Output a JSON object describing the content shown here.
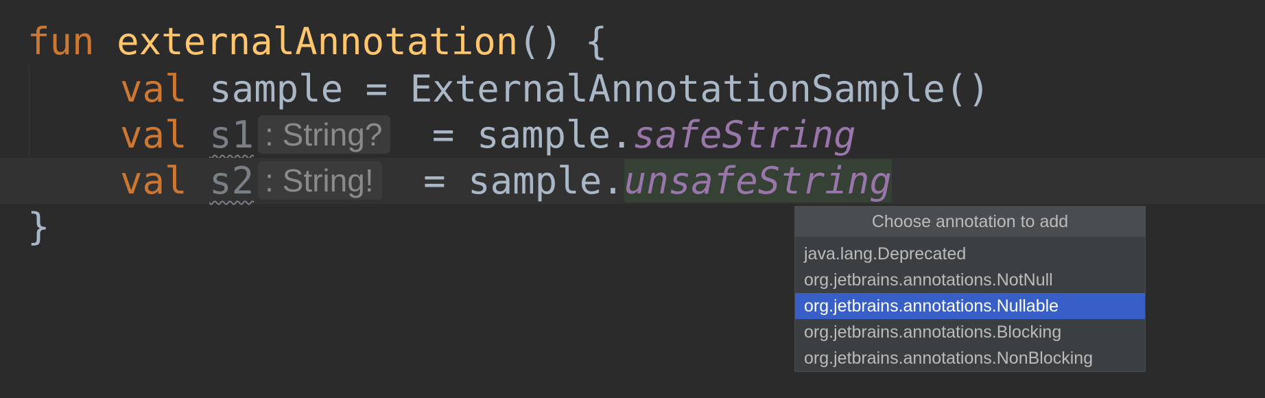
{
  "editor": {
    "lines": [
      {
        "kw": "fun",
        "name": "externalAnnotation",
        "rest": "() {"
      },
      {
        "kw": "val",
        "name": "sample",
        "rest": " = ExternalAnnotationSample()"
      },
      {
        "kw": "val",
        "var": "s1",
        "hint": ": String?",
        "rest": " = sample.",
        "prop": "safeString"
      },
      {
        "kw": "val",
        "var": "s2",
        "hint": ": String!",
        "rest": " = sample.",
        "prop": "unsafeString"
      },
      {
        "brace": "}"
      }
    ]
  },
  "popup": {
    "title": "Choose annotation to add",
    "items": [
      "java.lang.Deprecated",
      "org.jetbrains.annotations.NotNull",
      "org.jetbrains.annotations.Nullable",
      "org.jetbrains.annotations.Blocking",
      "org.jetbrains.annotations.NonBlocking"
    ],
    "selected_index": 2
  },
  "colors": {
    "background": "#2b2b2b",
    "keyword": "#cc7832",
    "function": "#ffc66d",
    "property": "#9876aa",
    "selection": "#375fc7"
  }
}
